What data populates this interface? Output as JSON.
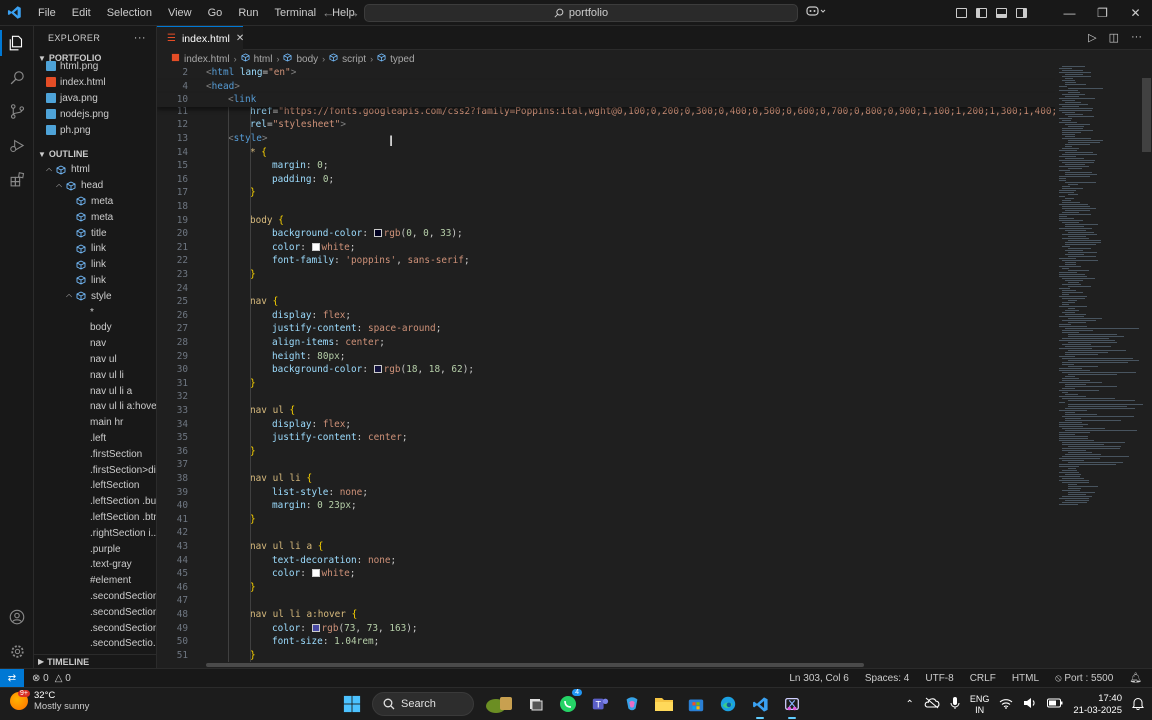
{
  "titlebar": {
    "menu": [
      "File",
      "Edit",
      "Selection",
      "View",
      "Go",
      "Run",
      "Terminal",
      "Help"
    ],
    "search_text": "portfolio"
  },
  "tab": {
    "label": "index.html"
  },
  "breadcrumb": [
    "index.html",
    "html",
    "body",
    "script",
    "typed"
  ],
  "explorer": {
    "title": "EXPLORER",
    "project": "PORTFOLIO",
    "files": [
      {
        "name": "html.png",
        "color": "#4ea3d8"
      },
      {
        "name": "index.html",
        "color": "#e44d26"
      },
      {
        "name": "java.png",
        "color": "#4ea3d8"
      },
      {
        "name": "nodejs.png",
        "color": "#4ea3d8"
      },
      {
        "name": "ph.png",
        "color": "#4ea3d8"
      }
    ]
  },
  "outline": {
    "title": "OUTLINE",
    "items": [
      {
        "label": "html",
        "depth": 0,
        "kind": "tag",
        "caret": "open"
      },
      {
        "label": "head",
        "depth": 1,
        "kind": "tag",
        "caret": "open"
      },
      {
        "label": "meta",
        "depth": 2,
        "kind": "tag"
      },
      {
        "label": "meta",
        "depth": 2,
        "kind": "tag"
      },
      {
        "label": "title",
        "depth": 2,
        "kind": "tag"
      },
      {
        "label": "link",
        "depth": 2,
        "kind": "tag"
      },
      {
        "label": "link",
        "depth": 2,
        "kind": "tag"
      },
      {
        "label": "link",
        "depth": 2,
        "kind": "tag"
      },
      {
        "label": "style",
        "depth": 2,
        "kind": "tag",
        "caret": "open"
      },
      {
        "label": "*",
        "depth": 3,
        "kind": "css"
      },
      {
        "label": "body",
        "depth": 3,
        "kind": "css"
      },
      {
        "label": "nav",
        "depth": 3,
        "kind": "css"
      },
      {
        "label": "nav ul",
        "depth": 3,
        "kind": "css"
      },
      {
        "label": "nav ul li",
        "depth": 3,
        "kind": "css"
      },
      {
        "label": "nav ul li a",
        "depth": 3,
        "kind": "css"
      },
      {
        "label": "nav ul li a:hover",
        "depth": 3,
        "kind": "css"
      },
      {
        "label": "main hr",
        "depth": 3,
        "kind": "css"
      },
      {
        "label": ".left",
        "depth": 3,
        "kind": "css"
      },
      {
        "label": ".firstSection",
        "depth": 3,
        "kind": "css"
      },
      {
        "label": ".firstSection>div",
        "depth": 3,
        "kind": "css"
      },
      {
        "label": ".leftSection",
        "depth": 3,
        "kind": "css"
      },
      {
        "label": ".leftSection .bu...",
        "depth": 3,
        "kind": "css"
      },
      {
        "label": ".leftSection .btn",
        "depth": 3,
        "kind": "css"
      },
      {
        "label": ".rightSection i...",
        "depth": 3,
        "kind": "css"
      },
      {
        "label": ".purple",
        "depth": 3,
        "kind": "css"
      },
      {
        "label": ".text-gray",
        "depth": 3,
        "kind": "css"
      },
      {
        "label": "#element",
        "depth": 3,
        "kind": "css"
      },
      {
        "label": ".secondSection",
        "depth": 3,
        "kind": "css"
      },
      {
        "label": ".secondSection...",
        "depth": 3,
        "kind": "css"
      },
      {
        "label": ".secondSection...",
        "depth": 3,
        "kind": "css"
      },
      {
        "label": ".secondSectio...",
        "depth": 3,
        "kind": "css"
      }
    ],
    "timeline": "TIMELINE"
  },
  "code": {
    "sticky": [
      {
        "n": "2",
        "indent": 0,
        "parts": [
          [
            "t-br",
            "<"
          ],
          [
            "t-tag",
            "html"
          ],
          [
            "t-pun",
            " "
          ],
          [
            "t-attr",
            "lang"
          ],
          [
            "t-pun",
            "="
          ],
          [
            "t-str",
            "\"en\""
          ],
          [
            "t-br",
            ">"
          ]
        ]
      },
      {
        "n": "4",
        "indent": 0,
        "parts": [
          [
            "t-br",
            "<"
          ],
          [
            "t-tag",
            "head"
          ],
          [
            "t-br",
            ">"
          ]
        ]
      },
      {
        "n": "10",
        "indent": 1,
        "parts": [
          [
            "t-br",
            "<"
          ],
          [
            "t-tag",
            "link"
          ]
        ]
      }
    ],
    "lines": [
      {
        "n": "11",
        "indent": 2,
        "parts": [
          [
            "t-attr",
            "href"
          ],
          [
            "t-pun",
            "="
          ],
          [
            "t-str",
            "\"https://fonts.googleapis.com/css2?family=Poppins:ital,wght@0,100;0,200;0,300;0,400;0,500;0,600;0,700;0,800;0,900;1,100;1,200;1,300;1,400;1,"
          ]
        ]
      },
      {
        "n": "12",
        "indent": 2,
        "parts": [
          [
            "t-attr",
            "rel"
          ],
          [
            "t-pun",
            "="
          ],
          [
            "t-str",
            "\"stylesheet\""
          ],
          [
            "t-br",
            ">"
          ]
        ]
      },
      {
        "n": "13",
        "indent": 1,
        "parts": [
          [
            "t-br",
            "<"
          ],
          [
            "t-tag",
            "style"
          ],
          [
            "t-br",
            ">"
          ]
        ]
      },
      {
        "n": "14",
        "indent": 2,
        "parts": [
          [
            "t-sel",
            "* "
          ],
          [
            "t-brace",
            "{"
          ]
        ]
      },
      {
        "n": "15",
        "indent": 3,
        "parts": [
          [
            "t-prop",
            "margin"
          ],
          [
            "t-pun",
            ": "
          ],
          [
            "t-num",
            "0"
          ],
          [
            "t-pun",
            ";"
          ]
        ]
      },
      {
        "n": "16",
        "indent": 3,
        "parts": [
          [
            "t-prop",
            "padding"
          ],
          [
            "t-pun",
            ": "
          ],
          [
            "t-num",
            "0"
          ],
          [
            "t-pun",
            ";"
          ]
        ]
      },
      {
        "n": "17",
        "indent": 2,
        "parts": [
          [
            "t-brace",
            "}"
          ]
        ]
      },
      {
        "n": "18",
        "indent": 0,
        "parts": []
      },
      {
        "n": "19",
        "indent": 2,
        "parts": [
          [
            "t-sel",
            "body "
          ],
          [
            "t-brace",
            "{"
          ]
        ]
      },
      {
        "n": "20",
        "indent": 3,
        "parts": [
          [
            "t-prop",
            "background-color"
          ],
          [
            "t-pun",
            ": "
          ],
          [
            "swatch",
            "#000021"
          ],
          [
            "t-val",
            "rgb"
          ],
          [
            "t-pun",
            "("
          ],
          [
            "t-num",
            "0"
          ],
          [
            "t-pun",
            ", "
          ],
          [
            "t-num",
            "0"
          ],
          [
            "t-pun",
            ", "
          ],
          [
            "t-num",
            "33"
          ],
          [
            "t-pun",
            ");"
          ]
        ]
      },
      {
        "n": "21",
        "indent": 3,
        "parts": [
          [
            "t-prop",
            "color"
          ],
          [
            "t-pun",
            ": "
          ],
          [
            "swatch",
            "#ffffff"
          ],
          [
            "t-val",
            "white"
          ],
          [
            "t-pun",
            ";"
          ]
        ]
      },
      {
        "n": "22",
        "indent": 3,
        "parts": [
          [
            "t-prop",
            "font-family"
          ],
          [
            "t-pun",
            ": "
          ],
          [
            "t-str",
            "'poppins'"
          ],
          [
            "t-pun",
            ", "
          ],
          [
            "t-val",
            "sans-serif"
          ],
          [
            "t-pun",
            ";"
          ]
        ]
      },
      {
        "n": "23",
        "indent": 2,
        "parts": [
          [
            "t-brace",
            "}"
          ]
        ]
      },
      {
        "n": "24",
        "indent": 0,
        "parts": []
      },
      {
        "n": "25",
        "indent": 2,
        "parts": [
          [
            "t-sel",
            "nav "
          ],
          [
            "t-brace",
            "{"
          ]
        ]
      },
      {
        "n": "26",
        "indent": 3,
        "parts": [
          [
            "t-prop",
            "display"
          ],
          [
            "t-pun",
            ": "
          ],
          [
            "t-val",
            "flex"
          ],
          [
            "t-pun",
            ";"
          ]
        ]
      },
      {
        "n": "27",
        "indent": 3,
        "parts": [
          [
            "t-prop",
            "justify-content"
          ],
          [
            "t-pun",
            ": "
          ],
          [
            "t-val",
            "space-around"
          ],
          [
            "t-pun",
            ";"
          ]
        ]
      },
      {
        "n": "28",
        "indent": 3,
        "parts": [
          [
            "t-prop",
            "align-items"
          ],
          [
            "t-pun",
            ": "
          ],
          [
            "t-val",
            "center"
          ],
          [
            "t-pun",
            ";"
          ]
        ]
      },
      {
        "n": "29",
        "indent": 3,
        "parts": [
          [
            "t-prop",
            "height"
          ],
          [
            "t-pun",
            ": "
          ],
          [
            "t-num",
            "80px"
          ],
          [
            "t-pun",
            ";"
          ]
        ]
      },
      {
        "n": "30",
        "indent": 3,
        "parts": [
          [
            "t-prop",
            "background-color"
          ],
          [
            "t-pun",
            ": "
          ],
          [
            "swatch",
            "#12123e"
          ],
          [
            "t-val",
            "rgb"
          ],
          [
            "t-pun",
            "("
          ],
          [
            "t-num",
            "18"
          ],
          [
            "t-pun",
            ", "
          ],
          [
            "t-num",
            "18"
          ],
          [
            "t-pun",
            ", "
          ],
          [
            "t-num",
            "62"
          ],
          [
            "t-pun",
            ");"
          ]
        ]
      },
      {
        "n": "31",
        "indent": 2,
        "parts": [
          [
            "t-brace",
            "}"
          ]
        ]
      },
      {
        "n": "32",
        "indent": 0,
        "parts": []
      },
      {
        "n": "33",
        "indent": 2,
        "parts": [
          [
            "t-sel",
            "nav ul "
          ],
          [
            "t-brace",
            "{"
          ]
        ]
      },
      {
        "n": "34",
        "indent": 3,
        "parts": [
          [
            "t-prop",
            "display"
          ],
          [
            "t-pun",
            ": "
          ],
          [
            "t-val",
            "flex"
          ],
          [
            "t-pun",
            ";"
          ]
        ]
      },
      {
        "n": "35",
        "indent": 3,
        "parts": [
          [
            "t-prop",
            "justify-content"
          ],
          [
            "t-pun",
            ": "
          ],
          [
            "t-val",
            "center"
          ],
          [
            "t-pun",
            ";"
          ]
        ]
      },
      {
        "n": "36",
        "indent": 2,
        "parts": [
          [
            "t-brace",
            "}"
          ]
        ]
      },
      {
        "n": "37",
        "indent": 0,
        "parts": []
      },
      {
        "n": "38",
        "indent": 2,
        "parts": [
          [
            "t-sel",
            "nav ul li "
          ],
          [
            "t-brace",
            "{"
          ]
        ]
      },
      {
        "n": "39",
        "indent": 3,
        "parts": [
          [
            "t-prop",
            "list-style"
          ],
          [
            "t-pun",
            ": "
          ],
          [
            "t-val",
            "none"
          ],
          [
            "t-pun",
            ";"
          ]
        ]
      },
      {
        "n": "40",
        "indent": 3,
        "parts": [
          [
            "t-prop",
            "margin"
          ],
          [
            "t-pun",
            ": "
          ],
          [
            "t-num",
            "0 23px"
          ],
          [
            "t-pun",
            ";"
          ]
        ]
      },
      {
        "n": "41",
        "indent": 2,
        "parts": [
          [
            "t-brace",
            "}"
          ]
        ]
      },
      {
        "n": "42",
        "indent": 0,
        "parts": []
      },
      {
        "n": "43",
        "indent": 2,
        "parts": [
          [
            "t-sel",
            "nav ul li a "
          ],
          [
            "t-brace",
            "{"
          ]
        ]
      },
      {
        "n": "44",
        "indent": 3,
        "parts": [
          [
            "t-prop",
            "text-decoration"
          ],
          [
            "t-pun",
            ": "
          ],
          [
            "t-val",
            "none"
          ],
          [
            "t-pun",
            ";"
          ]
        ]
      },
      {
        "n": "45",
        "indent": 3,
        "parts": [
          [
            "t-prop",
            "color"
          ],
          [
            "t-pun",
            ": "
          ],
          [
            "swatch",
            "#ffffff"
          ],
          [
            "t-val",
            "white"
          ],
          [
            "t-pun",
            ";"
          ]
        ]
      },
      {
        "n": "46",
        "indent": 2,
        "parts": [
          [
            "t-brace",
            "}"
          ]
        ]
      },
      {
        "n": "47",
        "indent": 0,
        "parts": []
      },
      {
        "n": "48",
        "indent": 2,
        "parts": [
          [
            "t-sel",
            "nav ul li a:hover "
          ],
          [
            "t-brace",
            "{"
          ]
        ]
      },
      {
        "n": "49",
        "indent": 3,
        "parts": [
          [
            "t-prop",
            "color"
          ],
          [
            "t-pun",
            ": "
          ],
          [
            "swatch",
            "#4949a3"
          ],
          [
            "t-val",
            "rgb"
          ],
          [
            "t-pun",
            "("
          ],
          [
            "t-num",
            "73"
          ],
          [
            "t-pun",
            ", "
          ],
          [
            "t-num",
            "73"
          ],
          [
            "t-pun",
            ", "
          ],
          [
            "t-num",
            "163"
          ],
          [
            "t-pun",
            ");"
          ]
        ]
      },
      {
        "n": "50",
        "indent": 3,
        "parts": [
          [
            "t-prop",
            "font-size"
          ],
          [
            "t-pun",
            ": "
          ],
          [
            "t-num",
            "1.04rem"
          ],
          [
            "t-pun",
            ";"
          ]
        ]
      },
      {
        "n": "51",
        "indent": 2,
        "parts": [
          [
            "t-brace",
            "}"
          ]
        ]
      },
      {
        "n": "52",
        "indent": 0,
        "parts": []
      }
    ]
  },
  "status": {
    "errors": "0",
    "warnings": "0",
    "position": "Ln 303, Col 6",
    "spaces": "Spaces: 4",
    "encoding": "UTF-8",
    "eol": "CRLF",
    "language": "HTML",
    "port": "Port : 5500"
  },
  "taskbar": {
    "weather_temp": "32°C",
    "weather_desc": "Mostly sunny",
    "weather_badge": "9+",
    "search_label": "Search",
    "lang_top": "ENG",
    "lang_bottom": "IN",
    "time": "17:40",
    "date": "21-03-2025",
    "teams_badge": "4"
  },
  "colors": {
    "accent": "#0078d4",
    "editor_bg": "#1f1f1f",
    "chrome_bg": "#181818"
  }
}
